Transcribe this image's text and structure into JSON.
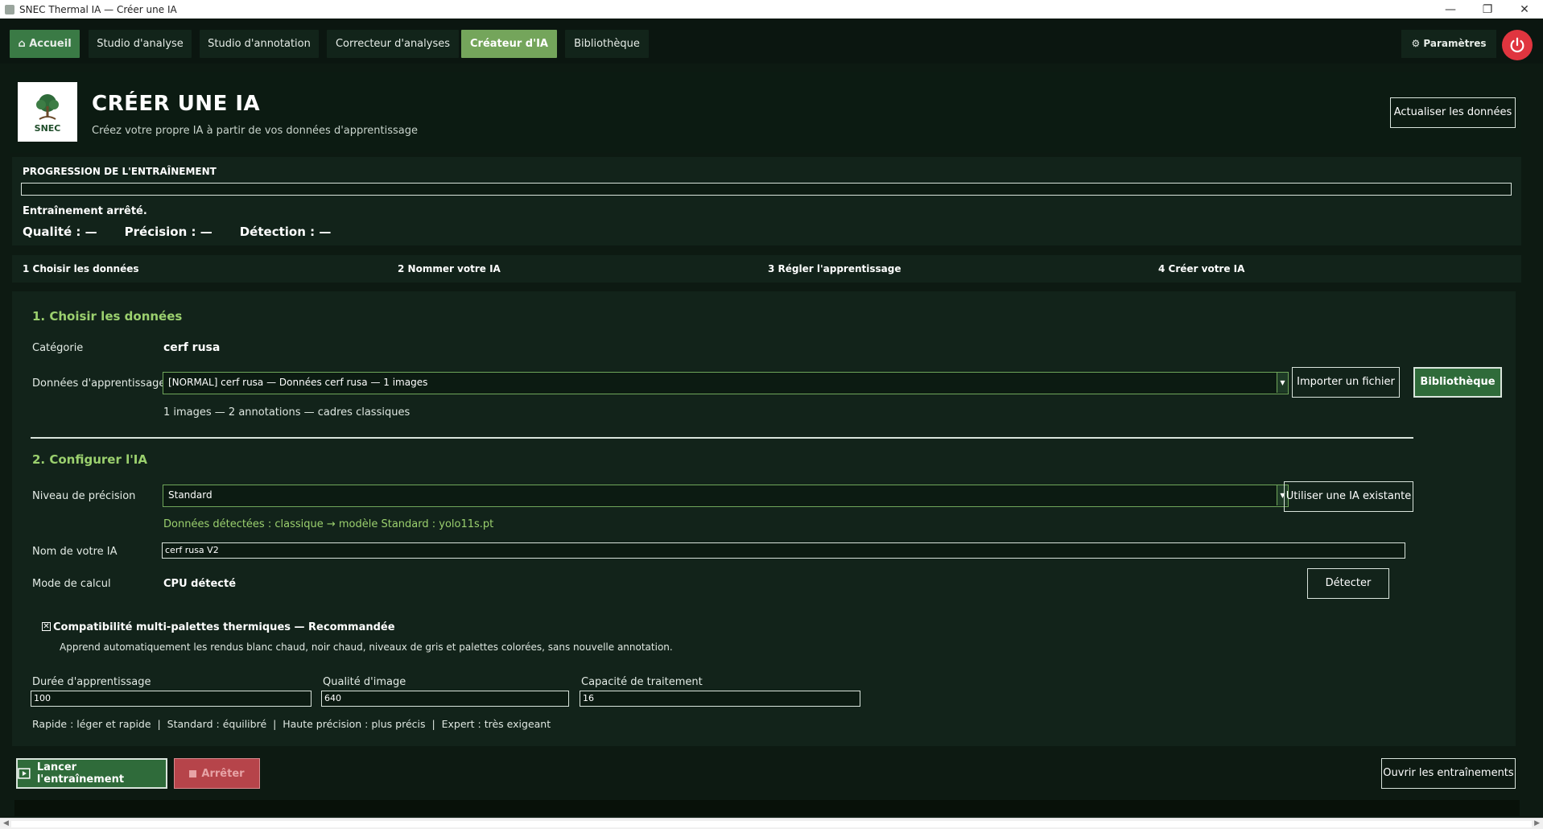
{
  "window": {
    "title": "SNEC Thermal IA — Créer une IA"
  },
  "nav": {
    "home": "Accueil",
    "tabs": [
      "Studio d'analyse",
      "Studio d'annotation",
      "Correcteur d'analyses",
      "Créateur d'IA",
      "Bibliothèque"
    ],
    "settings": "Paramètres",
    "accent_color": "#74a55b",
    "power_color": "#e0353f"
  },
  "header": {
    "title": "CRÉER UNE IA",
    "subtitle": "Créez votre propre IA à partir de vos données d'apprentissage",
    "refresh_button": "Actualiser les données",
    "logo_text": "SNEC"
  },
  "progress": {
    "title": "PROGRESSION DE L'ENTRAÎNEMENT",
    "fraction": 0,
    "status": "Entraînement arrêté.",
    "quality": "Qualité : —",
    "precision": "Précision : —",
    "detection": "Détection : —"
  },
  "steps": [
    "1  Choisir les données",
    "2  Nommer votre IA",
    "3  Régler l'apprentissage",
    "4  Créer votre IA"
  ],
  "section1": {
    "title": "1. Choisir les données",
    "category_label": "Catégorie",
    "category_value": "cerf rusa",
    "data_label": "Données d'apprentissage",
    "data_selected": "[NORMAL] cerf rusa — Données cerf rusa — 1 images",
    "import_button": "Importer un fichier",
    "library_button": "Bibliothèque",
    "summary": "1 images — 2 annotations — cadres classiques"
  },
  "section2": {
    "title": "2. Configurer l'IA",
    "precision_label": "Niveau de précision",
    "precision_selected": "Standard",
    "existing_button": "Utiliser une IA existante",
    "detected_info": "Données détectées : classique → modèle Standard : yolo11s.pt",
    "name_label": "Nom de votre IA",
    "name_value": "cerf rusa V2",
    "compute_label": "Mode de calcul",
    "compute_value": "CPU détecté",
    "detect_button": "Détecter",
    "multipalette_label": "Compatibilité multi-palettes thermiques — Recommandée",
    "multipalette_checked": true,
    "multipalette_desc": "Apprend automatiquement les rendus blanc chaud, noir chaud, niveaux de gris et palettes colorées, sans nouvelle annotation.",
    "duration_label": "Durée d'apprentissage",
    "duration_value": "100",
    "image_quality_label": "Qualité d'image",
    "image_quality_value": "640",
    "capacity_label": "Capacité de traitement",
    "capacity_value": "16",
    "presets_hint": "Rapide : léger et rapide  |  Standard : équilibré  |  Haute précision : plus précis  |  Expert : très exigeant"
  },
  "actions": {
    "launch": "Lancer l'entraînement",
    "stop": "Arrêter",
    "open_trainings": "Ouvrir les entraînements"
  }
}
